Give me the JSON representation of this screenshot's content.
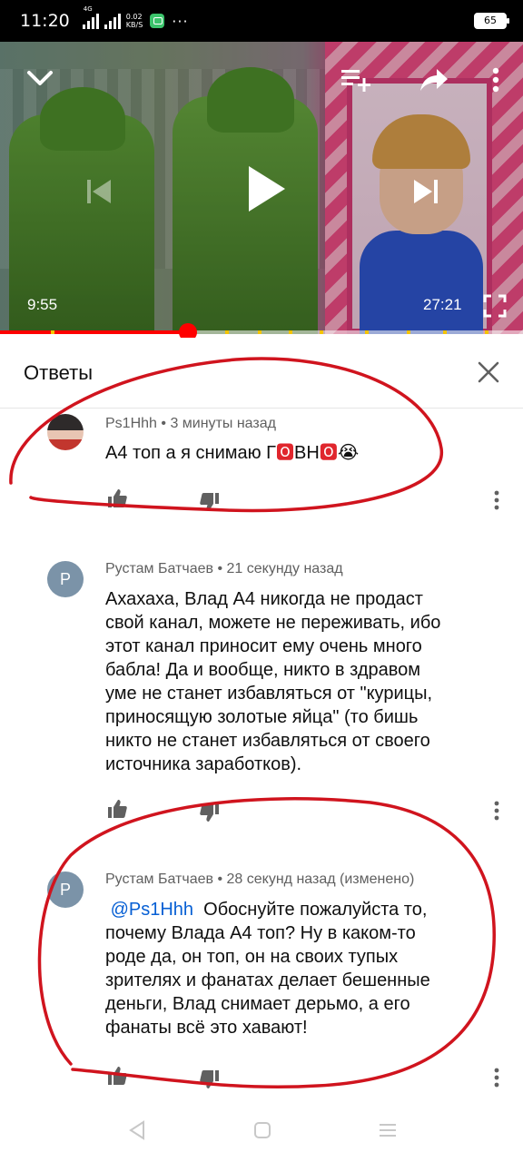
{
  "status_bar": {
    "time": "11:20",
    "network_type": "4G",
    "speed_value": "0.02",
    "speed_unit": "KB/S",
    "overflow": "···",
    "battery": "65"
  },
  "player": {
    "current_time": "9:55",
    "total_time": "27:21",
    "progress_fraction": 0.36,
    "icons": [
      "chevron-down-icon",
      "add-to-queue-icon",
      "share-icon",
      "more-vert-icon",
      "skip-previous-icon",
      "play-icon",
      "skip-next-icon",
      "fullscreen-icon"
    ]
  },
  "replies_panel": {
    "title": "Ответы"
  },
  "comments": [
    {
      "author": "Ps1Hhh",
      "time": "3 минуты назад",
      "text_parts": [
        "А4 топ а я снимаю Г",
        "ВН",
        ""
      ],
      "emoji_o": "🅾",
      "emoji_cry": "😭"
    },
    {
      "author": "Рустам Батчаев",
      "avatar_letter": "Р",
      "time": "21 секунду назад",
      "lines": [
        "Ахахаха, Влад А4 никогда не продаст",
        "свой канал, можете не переживать, ибо",
        "этот канал приносит ему очень много",
        "бабла! Да и вообще, никто в здравом",
        "уме не станет избавляться от \"курицы,",
        "приносящую золотые яйца\" (то бишь",
        "никто не станет избавляться от своего",
        "источника заработков)."
      ]
    },
    {
      "author": "Рустам Батчаев",
      "avatar_letter": "Р",
      "time": "28 секунд назад (изменено)",
      "mention": "@Ps1Hhh",
      "lines": [
        "Обоснуйте пожалуйста то,",
        "почему Влада А4 топ? Ну в каком-то",
        "роде да, он топ, он на своих тупых",
        "зрителях и фанатах делает бешенные",
        "деньги, Влад снимает дерьмо, а его",
        "фанаты всё это хавают!"
      ]
    }
  ],
  "separator": "•",
  "colors": {
    "accent_red": "#ff0000",
    "link_blue": "#065fd4",
    "annotation_red": "#d0141e",
    "meta_gray": "#606060"
  }
}
